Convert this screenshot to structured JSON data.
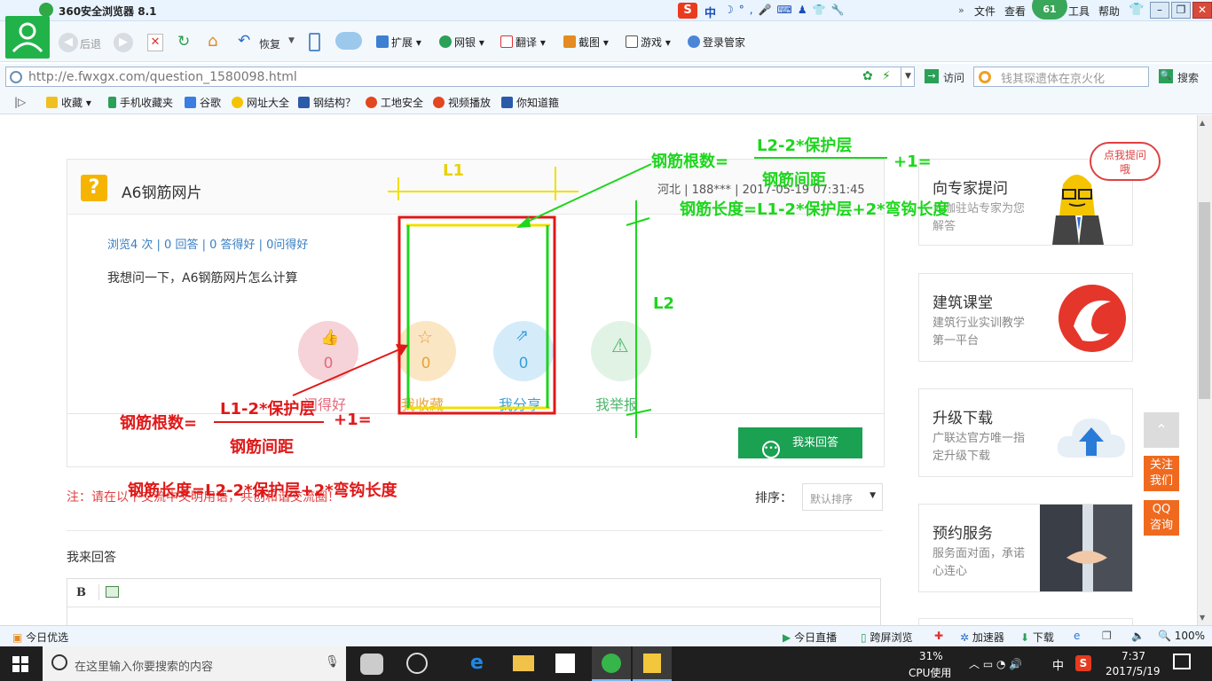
{
  "browser": {
    "title": "360安全浏览器 8.1",
    "menu": [
      "文件",
      "查看",
      "工具",
      "帮助"
    ],
    "badge": "61",
    "ime_char": "中",
    "nav": {
      "back": "后退",
      "restore": "恢复"
    },
    "toolbar": [
      "扩展",
      "网银",
      "翻译",
      "截图",
      "游戏",
      "登录管家"
    ],
    "url": "http://e.fwxgx.com/question_1580098.html",
    "go_label": "访问",
    "search_placeholder": "钱其琛遗体在京火化",
    "search_btn": "搜索",
    "bookmarks": [
      "收藏",
      "手机收藏夹",
      "谷歌",
      "网址大全",
      "钢结构？",
      "工地安全",
      "视频播放",
      "你知道箍"
    ]
  },
  "question": {
    "title": "A6钢筋网片",
    "meta": "河北 | 188*** | 2017-05-19 07:31:45",
    "stats": "浏览4 次 | 0 回答 | 0 答得好 | 0问得好",
    "body": "我想问一下，A6钢筋网片怎么计算",
    "actions": [
      {
        "label": "问得好",
        "count": "0",
        "color": "#f6d3d8",
        "fg": "#e36a7e"
      },
      {
        "label": "我收藏",
        "count": "0",
        "color": "#fbe6c4",
        "fg": "#e5a43b"
      },
      {
        "label": "我分享",
        "count": "0",
        "color": "#d4ecfa",
        "fg": "#3aa0dc"
      },
      {
        "label": "我举报",
        "count": "",
        "color": "#e1f3e5",
        "fg": "#4ab86a"
      }
    ],
    "answer_btn": "我来回答",
    "note": "注：请在以下交流中文明用语，共创和谐交流圈！",
    "sort_label": "排序：",
    "sort_value": "默认排序",
    "my_answer": "我来回答",
    "editor_bold": "B"
  },
  "sidebar": [
    {
      "title": "向专家提问",
      "desc": "大咖驻站专家为您解答",
      "bubble": "点我提问哦"
    },
    {
      "title": "建筑课堂",
      "desc": "建筑行业实训教学第一平台"
    },
    {
      "title": "升级下载",
      "desc": "广联达官方唯一指定升级下载"
    },
    {
      "title": "预约服务",
      "desc": "服务面对面，承诺心连心"
    }
  ],
  "float_buttons": [
    "关注我们",
    "QQ咨询"
  ],
  "annotations": {
    "green_count_prefix": "钢筋根数=",
    "green_numerator": "L2-2*保护层",
    "green_denominator": "钢筋间距",
    "green_suffix": "+1=",
    "green_length": "钢筋长度=L1-2*保护层+2*弯钩长度",
    "L1": "L1",
    "L2": "L2",
    "red_count_prefix": "钢筋根数=",
    "red_numerator": "L1-2*保护层",
    "red_denominator": "钢筋间距",
    "red_suffix": "+1=",
    "red_length": "钢筋长度=L2-2*保护层+2*弯钩长度"
  },
  "statusbar": {
    "left": "今日优选",
    "items": [
      "今日直播",
      "跨屏浏览",
      "加速器",
      "下载"
    ],
    "zoom": "100%"
  },
  "taskbar": {
    "search": "在这里输入你要搜索的内容",
    "cpu": "31%",
    "cpu_label": "CPU使用",
    "ime": "中",
    "time": "7:37",
    "date": "2017/5/19"
  },
  "colors": {
    "green_annot": "#1dd61d",
    "red_annot": "#e01818",
    "yellow_annot": "#f0e000",
    "answer_btn": "#1aa152",
    "float_btn": "#ef6a1f"
  }
}
